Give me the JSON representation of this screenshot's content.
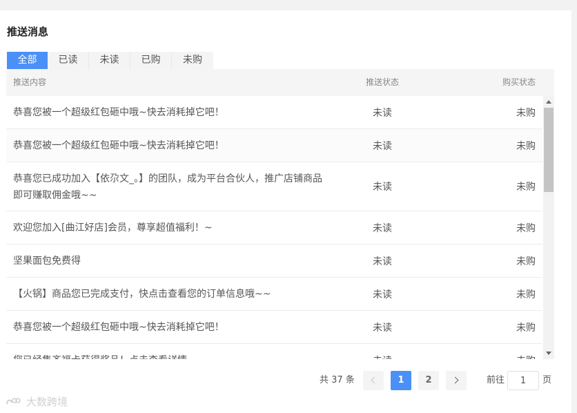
{
  "page_title": "推送消息",
  "tabs": [
    {
      "label": "全部",
      "active": true
    },
    {
      "label": "已读",
      "active": false
    },
    {
      "label": "未读",
      "active": false
    },
    {
      "label": "已购",
      "active": false
    },
    {
      "label": "未购",
      "active": false
    }
  ],
  "table": {
    "columns": {
      "content": "推送内容",
      "push_status": "推送状态",
      "buy_status": "购买状态"
    },
    "rows": [
      {
        "content": "恭喜您被一个超级红包砸中哦~快去消耗掉它吧！",
        "push_status": "未读",
        "buy_status": "未购"
      },
      {
        "content": "恭喜您被一个超级红包砸中哦~快去消耗掉它吧！",
        "push_status": "未读",
        "buy_status": "未购"
      },
      {
        "content": "恭喜您已成功加入【依尕文_。】的团队，成为平台合伙人，推广店铺商品即可赚取佣金哦~~",
        "push_status": "未读",
        "buy_status": "未购"
      },
      {
        "content": "欢迎您加入[曲江好店]会员，尊享超值福利！~",
        "push_status": "未读",
        "buy_status": "未购"
      },
      {
        "content": "坚果面包免费得",
        "push_status": "未读",
        "buy_status": "未购"
      },
      {
        "content": "【火锅】商品您已完成支付，快点击查看您的订单信息哦~~",
        "push_status": "未读",
        "buy_status": "未购"
      },
      {
        "content": "恭喜您被一个超级红包砸中哦~快去消耗掉它吧！",
        "push_status": "未读",
        "buy_status": "未购"
      },
      {
        "content": "您已经集齐福卡获得奖品！点击查看详情",
        "push_status": "未读",
        "buy_status": "未购"
      }
    ]
  },
  "pagination": {
    "total": "共 37 条",
    "pages": [
      "1",
      "2"
    ],
    "current": "1",
    "goto_label": "前往",
    "goto_value": "1",
    "goto_suffix": "页"
  },
  "watermark": "大数跨境",
  "colors": {
    "accent": "#4a90f7"
  }
}
